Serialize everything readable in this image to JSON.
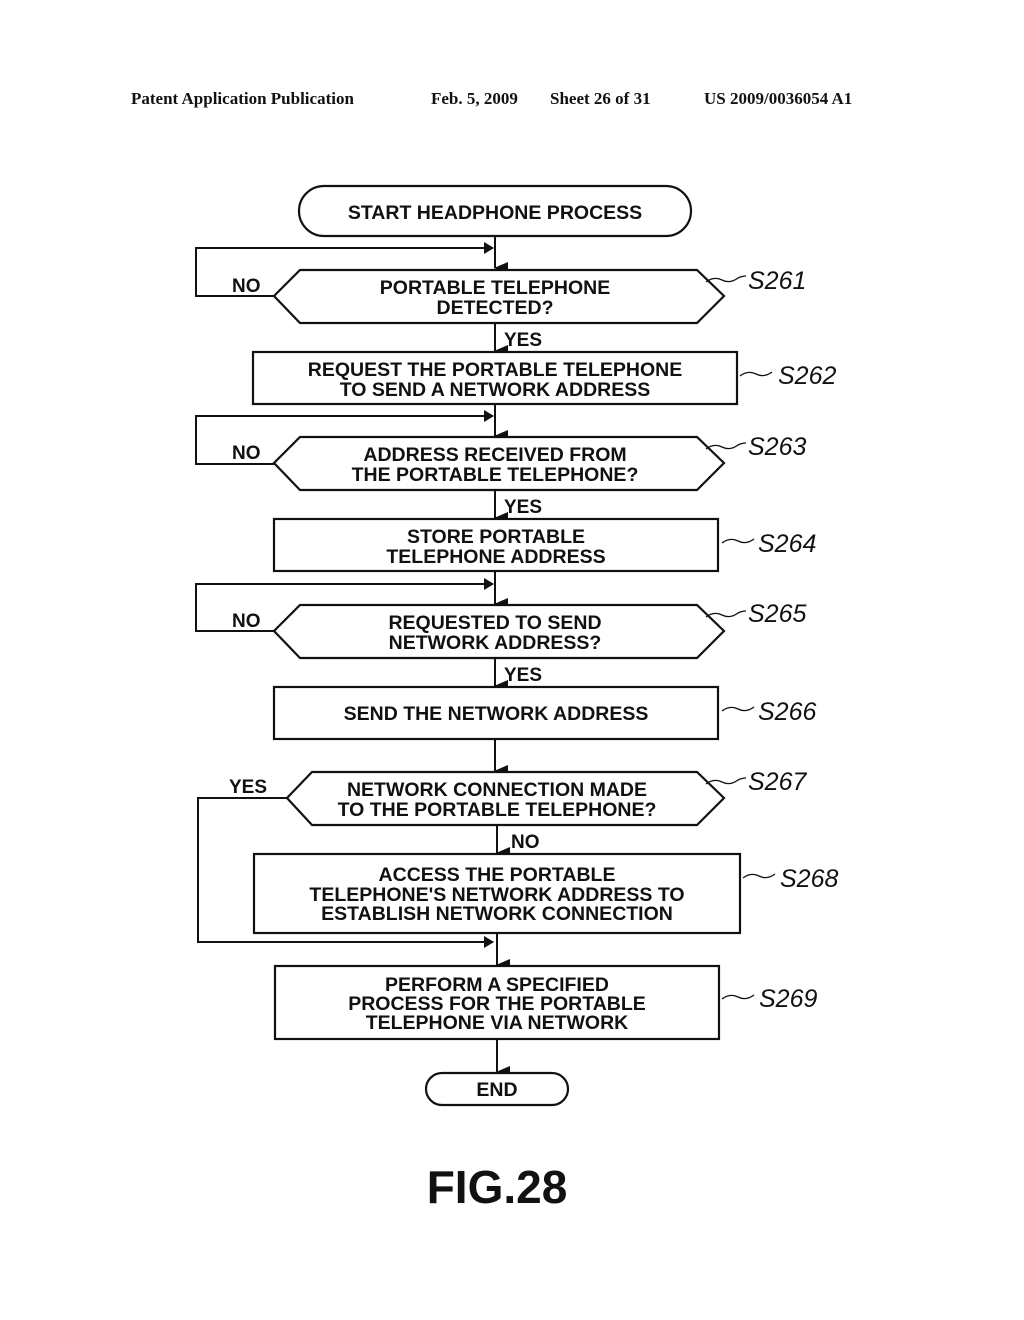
{
  "header": {
    "publication": "Patent Application Publication",
    "date": "Feb. 5, 2009",
    "sheet": "Sheet 26 of 31",
    "number": "US 2009/0036054 A1"
  },
  "flowchart": {
    "start": "START HEADPHONE PROCESS",
    "end": "END",
    "steps": [
      {
        "id": "S261",
        "type": "decision",
        "lines": [
          "PORTABLE TELEPHONE",
          "DETECTED?"
        ],
        "yes_label": "YES",
        "no_label": "NO"
      },
      {
        "id": "S262",
        "type": "process",
        "lines": [
          "REQUEST THE PORTABLE TELEPHONE",
          "TO SEND A NETWORK ADDRESS"
        ]
      },
      {
        "id": "S263",
        "type": "decision",
        "lines": [
          "ADDRESS RECEIVED FROM",
          "THE PORTABLE TELEPHONE?"
        ],
        "yes_label": "YES",
        "no_label": "NO"
      },
      {
        "id": "S264",
        "type": "process",
        "lines": [
          "STORE PORTABLE",
          "TELEPHONE ADDRESS"
        ]
      },
      {
        "id": "S265",
        "type": "decision",
        "lines": [
          "REQUESTED TO SEND",
          "NETWORK ADDRESS?"
        ],
        "yes_label": "YES",
        "no_label": "NO"
      },
      {
        "id": "S266",
        "type": "process",
        "lines": [
          "SEND THE NETWORK ADDRESS"
        ]
      },
      {
        "id": "S267",
        "type": "decision",
        "lines": [
          "NETWORK CONNECTION MADE",
          "TO THE PORTABLE TELEPHONE?"
        ],
        "yes_label": "YES",
        "no_label": "NO"
      },
      {
        "id": "S268",
        "type": "process",
        "lines": [
          "ACCESS THE PORTABLE",
          "TELEPHONE'S NETWORK ADDRESS TO",
          "ESTABLISH NETWORK CONNECTION"
        ]
      },
      {
        "id": "S269",
        "type": "process",
        "lines": [
          "PERFORM A SPECIFIED",
          "PROCESS FOR THE PORTABLE",
          "TELEPHONE VIA NETWORK"
        ]
      }
    ]
  },
  "figure_label": "FIG.28"
}
